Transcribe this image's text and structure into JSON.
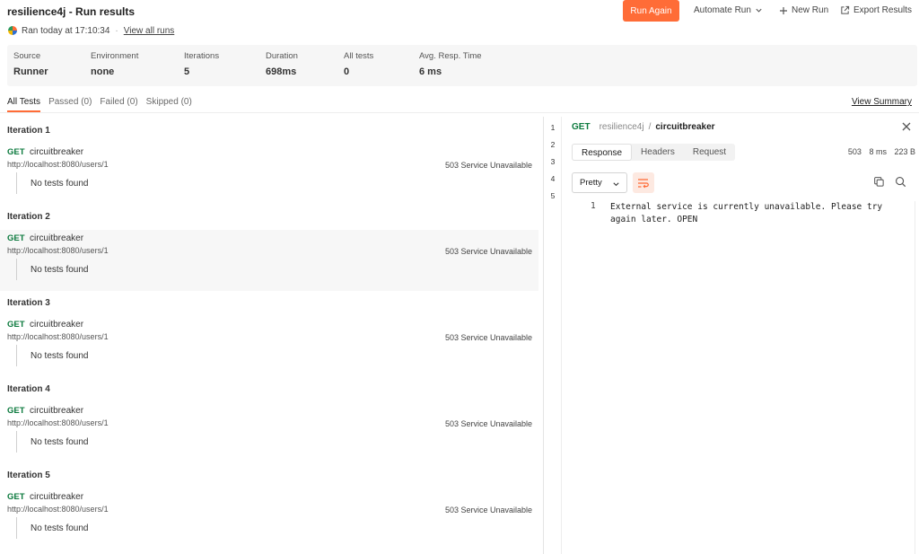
{
  "header": {
    "title": "resilience4j - Run results",
    "ran_text": "Ran today at 17:10:34",
    "view_all_runs": "View all runs",
    "run_again": "Run Again",
    "automate_run": "Automate Run",
    "new_run": "New Run",
    "export_results": "Export Results"
  },
  "summary": [
    {
      "label": "Source",
      "value": "Runner"
    },
    {
      "label": "Environment",
      "value": "none"
    },
    {
      "label": "Iterations",
      "value": "5"
    },
    {
      "label": "Duration",
      "value": "698ms"
    },
    {
      "label": "All tests",
      "value": "0"
    },
    {
      "label": "Avg. Resp. Time",
      "value": "6 ms"
    }
  ],
  "tabs": [
    "All Tests",
    "Passed (0)",
    "Failed (0)",
    "Skipped (0)"
  ],
  "view_summary": "View Summary",
  "iterations": [
    {
      "title": "Iteration 1",
      "method": "GET",
      "name": "circuitbreaker",
      "url": "http://localhost:8080/users/1",
      "status": "503 Service Unavailable",
      "tests": "No tests found"
    },
    {
      "title": "Iteration 2",
      "method": "GET",
      "name": "circuitbreaker",
      "url": "http://localhost:8080/users/1",
      "status": "503 Service Unavailable",
      "tests": "No tests found"
    },
    {
      "title": "Iteration 3",
      "method": "GET",
      "name": "circuitbreaker",
      "url": "http://localhost:8080/users/1",
      "status": "503 Service Unavailable",
      "tests": "No tests found"
    },
    {
      "title": "Iteration 4",
      "method": "GET",
      "name": "circuitbreaker",
      "url": "http://localhost:8080/users/1",
      "status": "503 Service Unavailable",
      "tests": "No tests found"
    },
    {
      "title": "Iteration 5",
      "method": "GET",
      "name": "circuitbreaker",
      "url": "http://localhost:8080/users/1",
      "status": "503 Service Unavailable",
      "tests": "No tests found"
    }
  ],
  "gutter_numbers": [
    "1",
    "2",
    "3",
    "4",
    "5"
  ],
  "detail": {
    "method": "GET",
    "collection": "resilience4j",
    "separator": "/",
    "request": "circuitbreaker",
    "tabs": [
      "Response",
      "Headers",
      "Request"
    ],
    "status_code": "503",
    "time": "8 ms",
    "size": "223 B",
    "format": "Pretty",
    "body_line_number": "1",
    "body": "External service is currently unavailable. Please try again later. OPEN"
  },
  "colors": {
    "accent": "#ff6c37",
    "method_get": "#0c7a3e"
  }
}
